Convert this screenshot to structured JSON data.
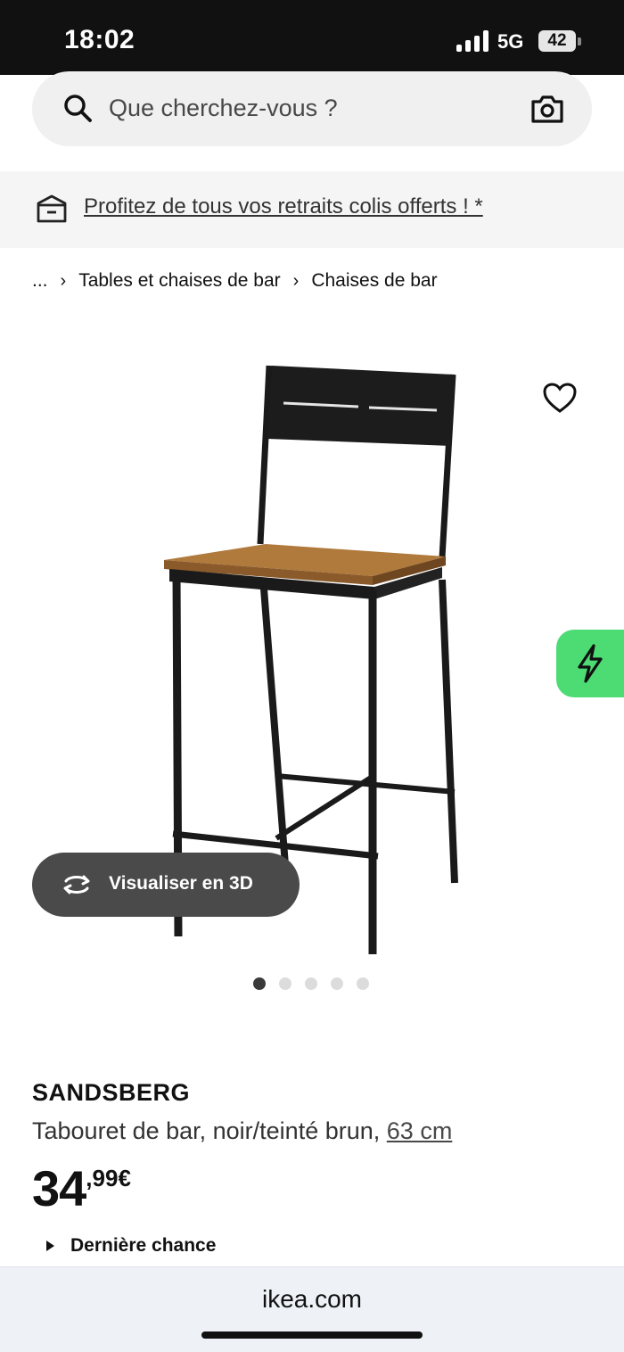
{
  "status_bar": {
    "time": "18:02",
    "network": "5G",
    "battery": "42"
  },
  "search": {
    "placeholder": "Que cherchez-vous ?"
  },
  "promo": {
    "text": "Profitez de tous vos retraits colis offerts ! *"
  },
  "breadcrumb": {
    "ellipsis": "...",
    "items": [
      "Tables et chaises de bar",
      "Chaises de bar"
    ]
  },
  "media": {
    "view_3d_label": "Visualiser en 3D",
    "image_count": 5,
    "active_index": 0
  },
  "product": {
    "brand": "SANDSBERG",
    "description": "Tabouret de bar, noir/teinté brun,",
    "size": "63 cm",
    "price_int": "34",
    "price_dec": ",99€",
    "last_chance": "Dernière chance"
  },
  "browser": {
    "url": "ikea.com"
  },
  "colors": {
    "flash_green": "#4ddb74",
    "seat_brown": "#b07a3c",
    "frame_black": "#1a1a1a"
  }
}
